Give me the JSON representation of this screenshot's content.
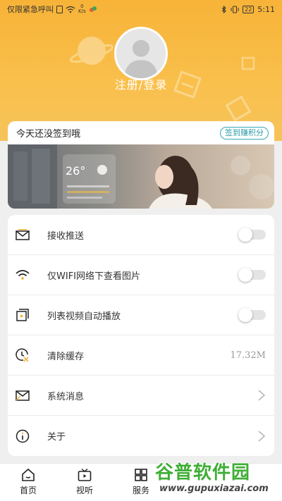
{
  "status_bar": {
    "carrier": "仅限紧急呼叫",
    "speed_value": "0",
    "speed_unit": "K/s",
    "battery": "22",
    "time": "5:11"
  },
  "profile": {
    "login_label": "注册/登录"
  },
  "signin": {
    "title": "今天还没签到哦",
    "button_label": "签到赚积分",
    "banner_temp": "26°"
  },
  "settings": {
    "items": [
      {
        "label": "接收推送",
        "icon": "envelope-push-icon",
        "control": "toggle",
        "on": false
      },
      {
        "label": "仅WIFI网络下查看图片",
        "icon": "wifi-icon",
        "control": "toggle",
        "on": false
      },
      {
        "label": "列表视频自动播放",
        "icon": "video-play-icon",
        "control": "toggle",
        "on": false
      },
      {
        "label": "清除缓存",
        "icon": "clock-clear-icon",
        "control": "value",
        "value": "17.32M"
      },
      {
        "label": "系统消息",
        "icon": "mail-icon",
        "control": "chevron"
      },
      {
        "label": "关于",
        "icon": "info-icon",
        "control": "chevron"
      }
    ]
  },
  "tabbar": {
    "tabs": [
      {
        "label": "首页",
        "icon": "home-icon"
      },
      {
        "label": "视听",
        "icon": "tv-icon"
      },
      {
        "label": "服务",
        "icon": "grid-icon"
      }
    ]
  },
  "watermark": {
    "title": "谷普软件园",
    "url": "www.gupuxiazai.com"
  },
  "colors": {
    "header_gradient_top": "#f7b338",
    "accent_teal": "#38a7b3",
    "watermark_green": "#3fae36"
  }
}
